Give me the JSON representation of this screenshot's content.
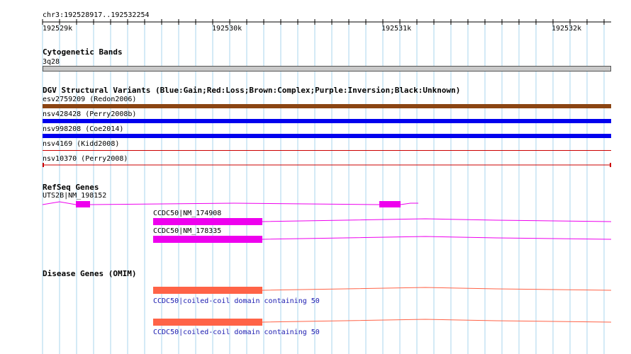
{
  "locus": {
    "range": "chr3:192528917..192532254"
  },
  "ruler": {
    "ticks": [
      "192529k",
      "192530k",
      "192531k",
      "192532k"
    ]
  },
  "cytoband": {
    "title": "Cytogenetic Bands",
    "band": "3q28"
  },
  "dgv": {
    "title": "DGV Structural Variants (Blue:Gain;Red:Loss;Brown:Complex;Purple:Inversion;Black:Unknown)",
    "variants": [
      {
        "label": "esv2759209 (Redon2006)",
        "type": "Complex",
        "color": "#8b4513"
      },
      {
        "label": "nsv428428 (Perry2008b)",
        "type": "Gain",
        "color": "#0000ee"
      },
      {
        "label": "nsv998208 (Coe2014)",
        "type": "Gain",
        "color": "#0000ee"
      },
      {
        "label": "nsv4169 (Kidd2008)",
        "type": "Loss",
        "color": "#cc0000"
      },
      {
        "label": "nsv10370 (Perry2008)",
        "type": "Loss",
        "color": "#cc0000"
      }
    ]
  },
  "refseq": {
    "title": "RefSeq Genes",
    "genes": [
      {
        "label": "UTS2B|NM_198152",
        "color": "#ee00ee"
      },
      {
        "label": "CCDC50|NM_174908",
        "color": "#ee00ee"
      },
      {
        "label": "CCDC50|NM_178335",
        "color": "#ee00ee"
      }
    ]
  },
  "omim": {
    "title": "Disease Genes (OMIM)",
    "genes": [
      {
        "label": "CCDC50|coiled-coil domain containing 50",
        "color": "#ff6347"
      },
      {
        "label": "CCDC50|coiled-coil domain containing 50",
        "color": "#ff6347"
      }
    ]
  },
  "colors": {
    "grid": "#aad4ee",
    "cytoband_fill": "#c8c8c8"
  }
}
